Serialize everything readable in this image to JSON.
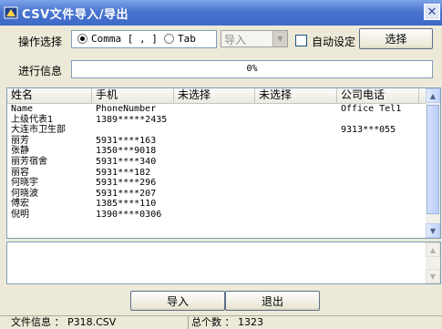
{
  "window": {
    "title": "CSV文件导入/导出"
  },
  "options": {
    "label": "操作选择",
    "radio_comma": "Comma [ , ]",
    "radio_tab": "Tab",
    "mode_select": "导入",
    "auto_label": "自动设定",
    "select_button": "选择"
  },
  "progress": {
    "label": "进行信息",
    "text": "0%",
    "value": 0
  },
  "table": {
    "columns": [
      "姓名",
      "手机",
      "未选择",
      "未选择",
      "公司电话"
    ],
    "rows": [
      [
        "Name",
        "PhoneNumber",
        "",
        "",
        "Office Tel1"
      ],
      [
        "上级代表1",
        "1389*****2435",
        "",
        "",
        ""
      ],
      [
        "大连市卫生部",
        "",
        "",
        "",
        "9313***055"
      ],
      [
        "丽芳",
        "5931****163",
        "",
        "",
        ""
      ],
      [
        "张静",
        "1350***9018",
        "",
        "",
        ""
      ],
      [
        "丽芳宿舍",
        "5931****340",
        "",
        "",
        ""
      ],
      [
        "丽容",
        "5931***182",
        "",
        "",
        ""
      ],
      [
        "何晓宇",
        "5931****296",
        "",
        "",
        ""
      ],
      [
        "何晓波",
        "5931****207",
        "",
        "",
        ""
      ],
      [
        "傅宏",
        "1385****110",
        "",
        "",
        ""
      ],
      [
        "倪明",
        "1390****0306",
        "",
        "",
        ""
      ],
      [
        "",
        "",
        "",
        "",
        ""
      ]
    ]
  },
  "buttons": {
    "import": "导入",
    "exit": "退出"
  },
  "status": {
    "file_label": "文件信息 ： P318.CSV",
    "total_label": "总个数 ： 1323"
  }
}
